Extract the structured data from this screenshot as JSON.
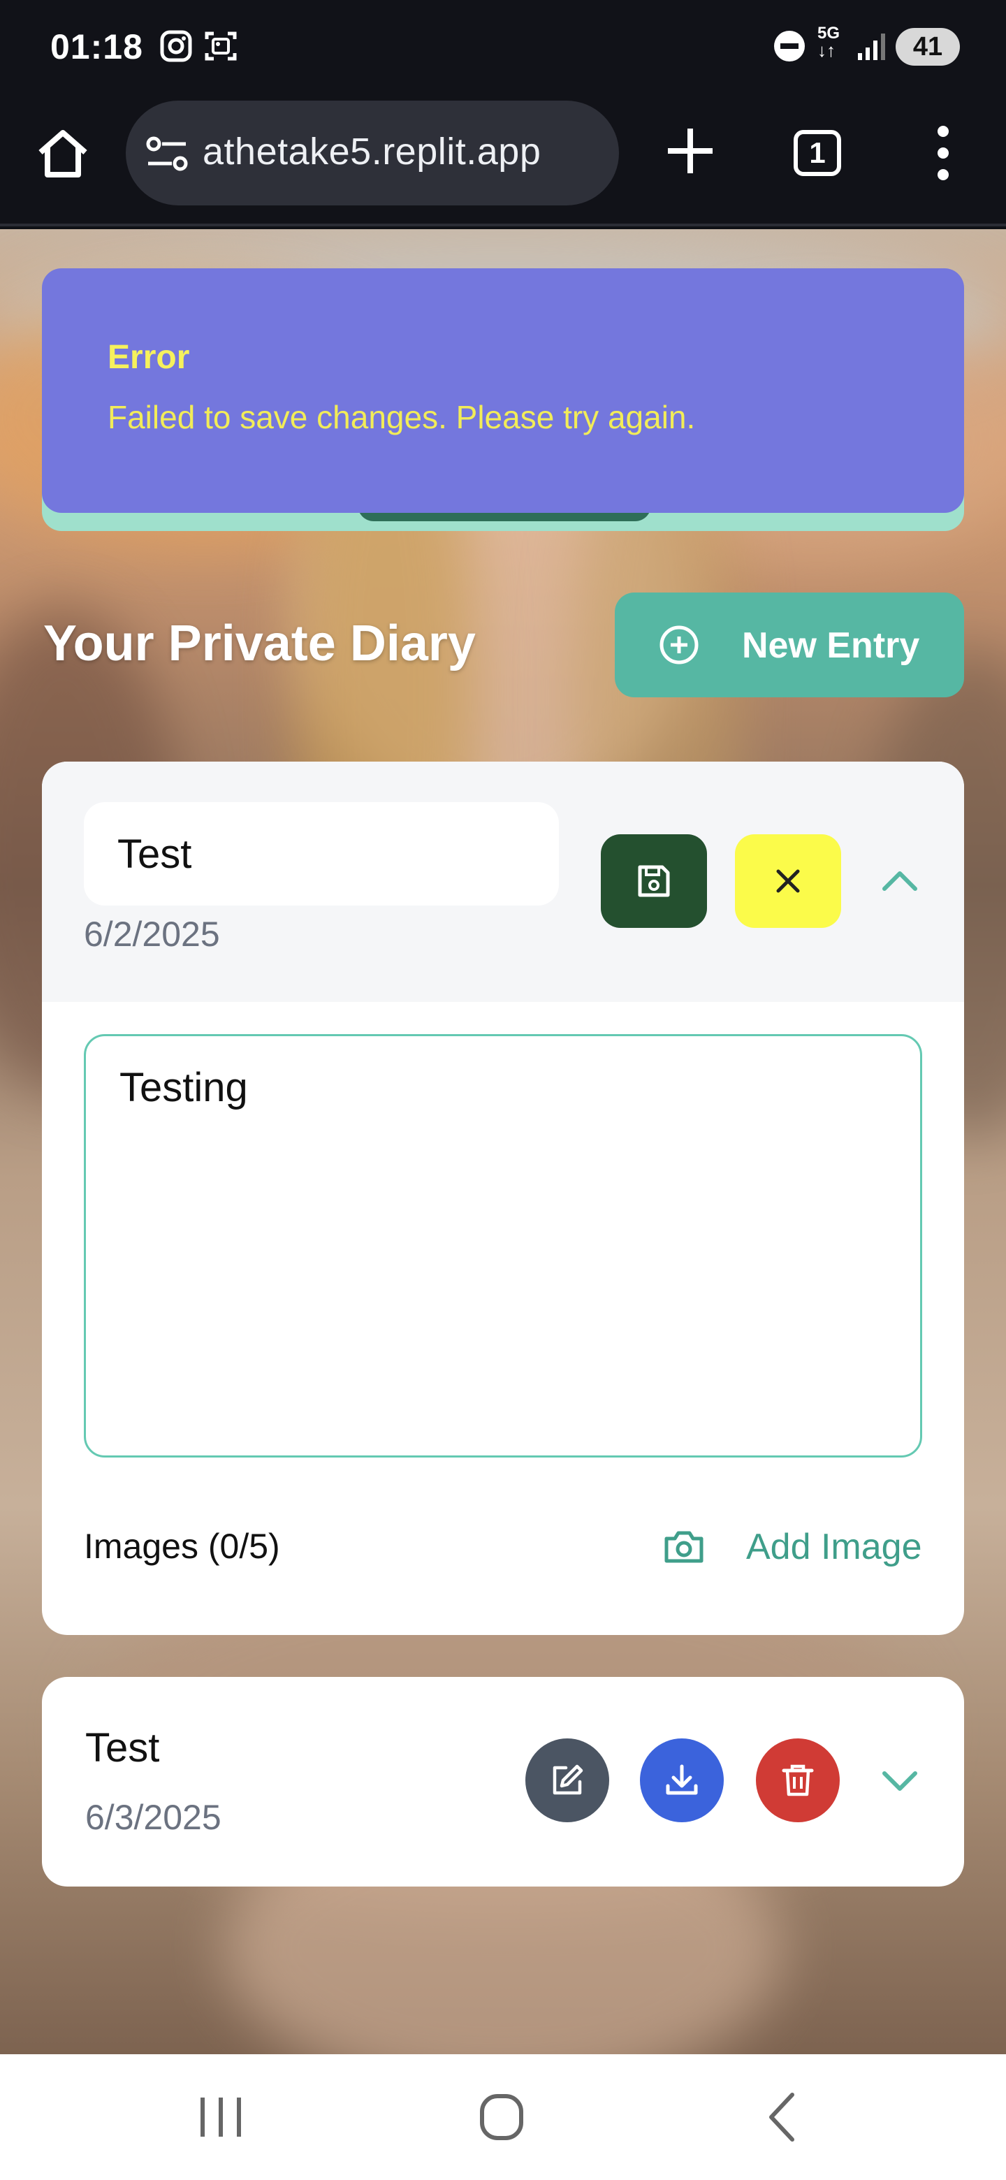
{
  "status_bar": {
    "time": "01:18",
    "network": "5G",
    "battery": "41",
    "icons": [
      "instagram-icon",
      "screenshot-icon",
      "dnd-icon",
      "data-arrows-icon",
      "signal-icon"
    ]
  },
  "browser": {
    "url": "athetake5.replit.app",
    "tab_count": "1",
    "icons": [
      "home-icon",
      "site-settings-icon",
      "new-tab-plus-icon",
      "tabs-icon",
      "more-vert-icon"
    ]
  },
  "toast": {
    "title": "Error",
    "message": "Failed to save changes. Please try again.",
    "background": "#7477dd",
    "text_color": "#f2ec58"
  },
  "header": {
    "title": "Your Private Diary",
    "new_entry_label": "New Entry"
  },
  "entries": [
    {
      "title": "Test",
      "date": "6/2/2025",
      "content": "Testing",
      "images_label": "Images (0/5)",
      "add_image_label": "Add Image",
      "state": "editing"
    },
    {
      "title": "Test",
      "date": "6/3/2025",
      "state": "collapsed"
    }
  ],
  "colors": {
    "accent": "#56b7a3",
    "save": "#24502f",
    "cancel": "#fbfb4a",
    "edit": "#4b5563",
    "download": "#3b63dc",
    "delete": "#d03b35"
  }
}
